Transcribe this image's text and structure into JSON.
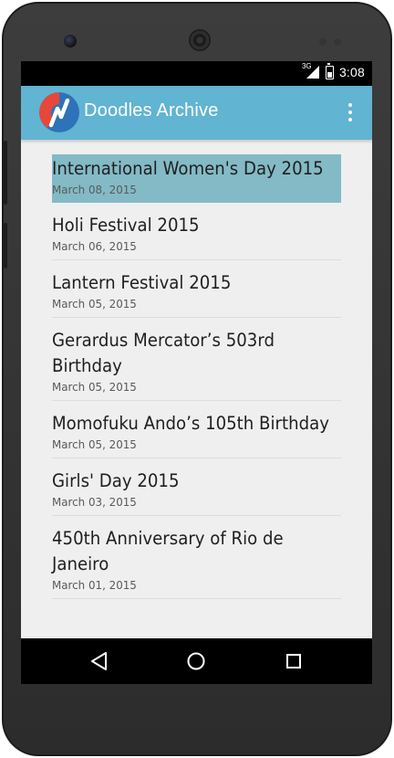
{
  "status_bar": {
    "network": "3G",
    "time": "3:08"
  },
  "app_bar": {
    "title": "Doodles Archive",
    "logo_icon": "doodles-logo-icon",
    "menu_icon": "overflow-menu-icon"
  },
  "colors": {
    "app_bar": "#61b4d2",
    "selected_row": "#83bac6",
    "background": "#efefef"
  },
  "doodles": [
    {
      "title": "International Women's Day 2015",
      "date": "March 08, 2015",
      "selected": true
    },
    {
      "title": "Holi Festival 2015",
      "date": "March 06, 2015"
    },
    {
      "title": "Lantern Festival 2015",
      "date": "March 05, 2015"
    },
    {
      "title": "Gerardus Mercator’s 503rd Birthday",
      "date": "March 05, 2015"
    },
    {
      "title": "Momofuku Ando’s 105th Birthday",
      "date": "March 05, 2015"
    },
    {
      "title": "Girls' Day 2015",
      "date": "March 03, 2015"
    },
    {
      "title": "450th Anniversary of Rio de Janeiro",
      "date": "March 01, 2015"
    }
  ],
  "nav_bar": {
    "back_icon": "back-triangle-icon",
    "home_icon": "home-circle-icon",
    "recents_icon": "recents-square-icon"
  }
}
